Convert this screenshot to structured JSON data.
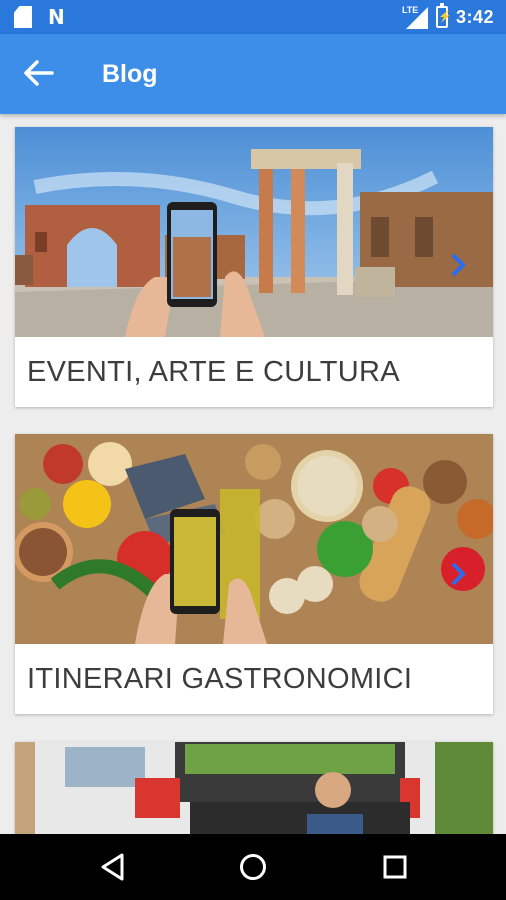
{
  "status_bar": {
    "time": "3:42",
    "network_label": "LTE",
    "icons": [
      "sd-card-icon",
      "n-notification-icon",
      "lte-signal-icon",
      "battery-charging-icon"
    ]
  },
  "app_bar": {
    "title": "Blog",
    "back_icon": "arrow-back-icon"
  },
  "cards": [
    {
      "title": "EVENTI, ARTE E CULTURA",
      "image": "pompeii-ruins-phone-photo",
      "arrow_icon": "chevron-right-icon"
    },
    {
      "title": "ITINERARI GASTRONOMICI",
      "image": "italian-food-spread-phone-photo",
      "arrow_icon": "chevron-right-icon"
    },
    {
      "title": "",
      "image": "car-trunk-stressed-man-photo"
    }
  ],
  "nav_bar": {
    "icons": [
      "back-triangle-icon",
      "home-circle-icon",
      "recents-square-icon"
    ]
  },
  "colors": {
    "status_bar": "#2a78dc",
    "app_bar": "#3d8ee8",
    "background": "#ededed",
    "card": "#ffffff",
    "card_title": "#3d3d3d",
    "nav_bar": "#000000"
  }
}
